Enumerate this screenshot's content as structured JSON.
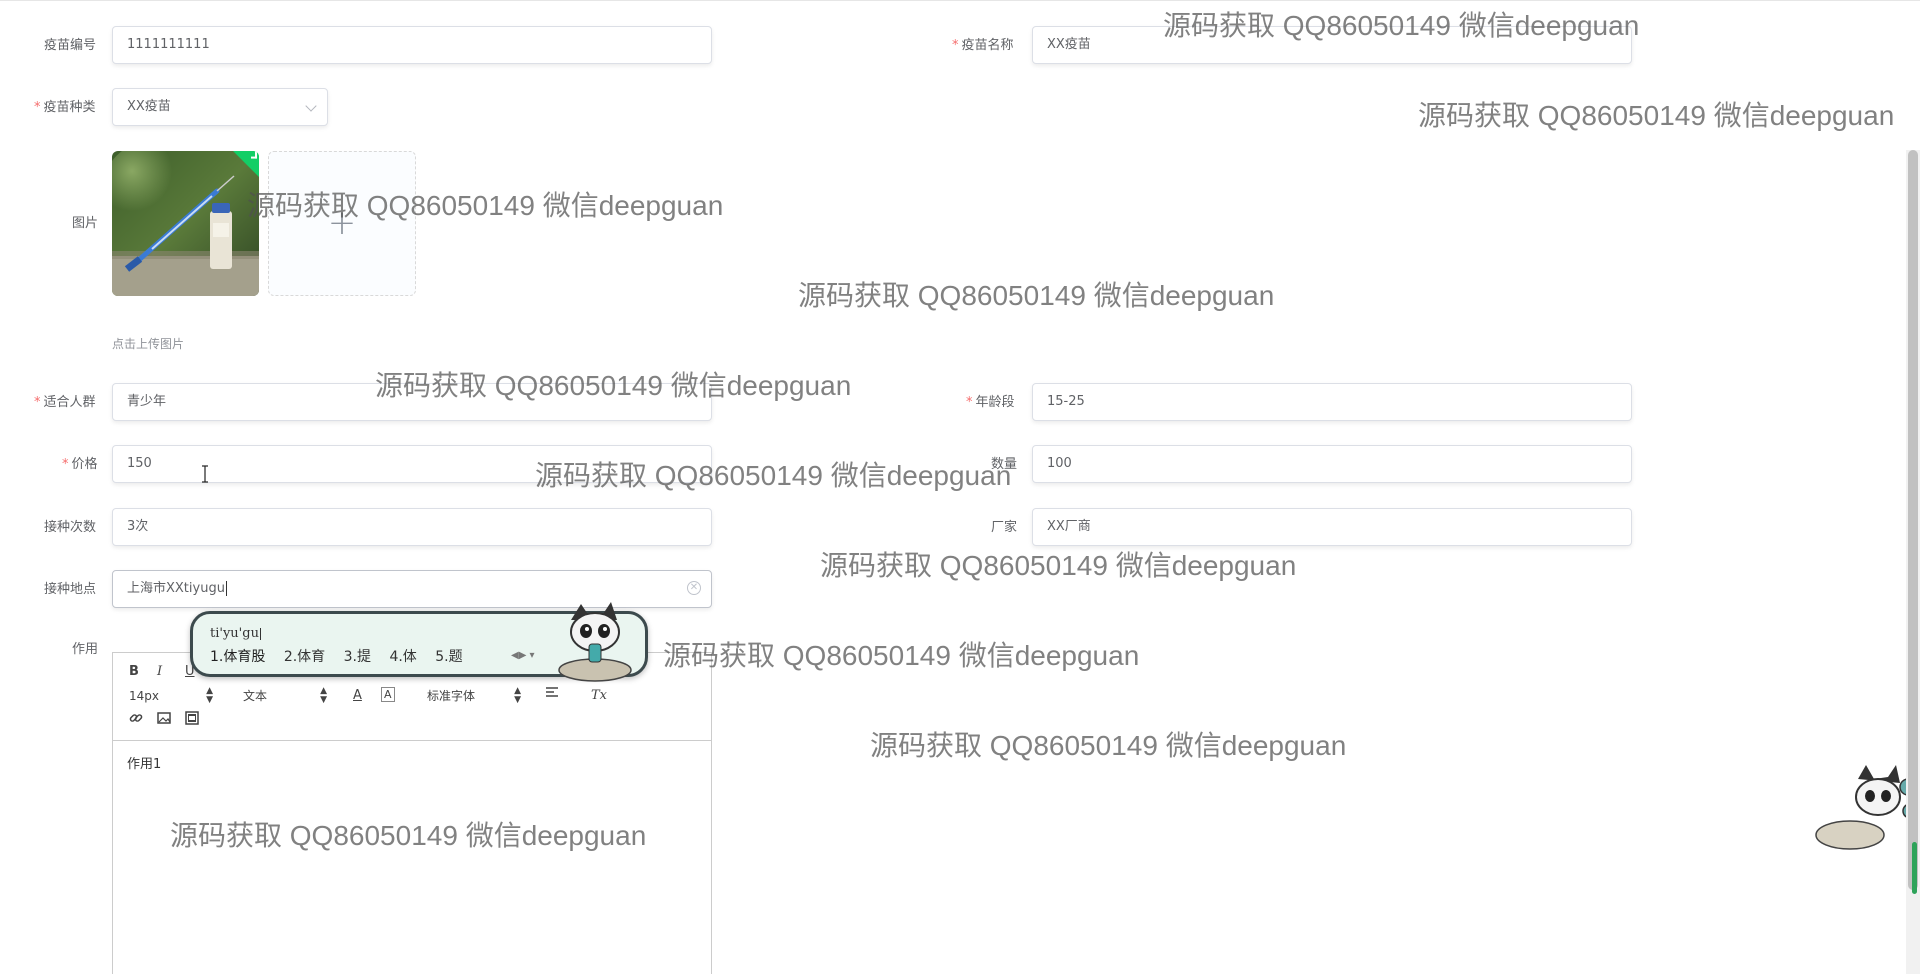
{
  "form": {
    "vaccine_code": {
      "label": "疫苗编号",
      "value": "1111111111"
    },
    "vaccine_name": {
      "label": "疫苗名称",
      "value": "XX疫苗",
      "required": "*"
    },
    "vaccine_type": {
      "label": "疫苗种类",
      "value": "XX疫苗",
      "required": "*"
    },
    "picture": {
      "label": "图片",
      "upload_tip": "点击上传图片",
      "plus": "+"
    },
    "target_group": {
      "label": "适合人群",
      "value": "青少年",
      "required": "*"
    },
    "age_range": {
      "label": "年龄段",
      "value": "15-25",
      "required": "*"
    },
    "price": {
      "label": "价格",
      "value": "150",
      "required": "*"
    },
    "quantity": {
      "label": "数量",
      "value": "100"
    },
    "dose_count": {
      "label": "接种次数",
      "value": "3次"
    },
    "manufacturer": {
      "label": "厂家",
      "value": "XX厂商"
    },
    "location": {
      "label": "接种地点",
      "value": "上海市XXtiyugu",
      "clear": "✕"
    },
    "effect": {
      "label": "作用"
    }
  },
  "editor": {
    "toolbar": {
      "bold": "B",
      "italic": "I",
      "underline": "U",
      "font_size": "14px",
      "block_type": "文本",
      "font_family": "标准字体",
      "clear_format": "Tx"
    },
    "content": "作用1"
  },
  "ime": {
    "pinyin": "ti'yu'gu",
    "candidates": [
      "1.体育股",
      "2.体育",
      "3.提",
      "4.体",
      "5.题"
    ]
  },
  "watermark": "源码获取 QQ86050149 微信deepguan",
  "colors": {
    "required": "#f56c6c",
    "border": "#dcdfe6",
    "text": "#606266",
    "upload_check": "#13ce66"
  }
}
